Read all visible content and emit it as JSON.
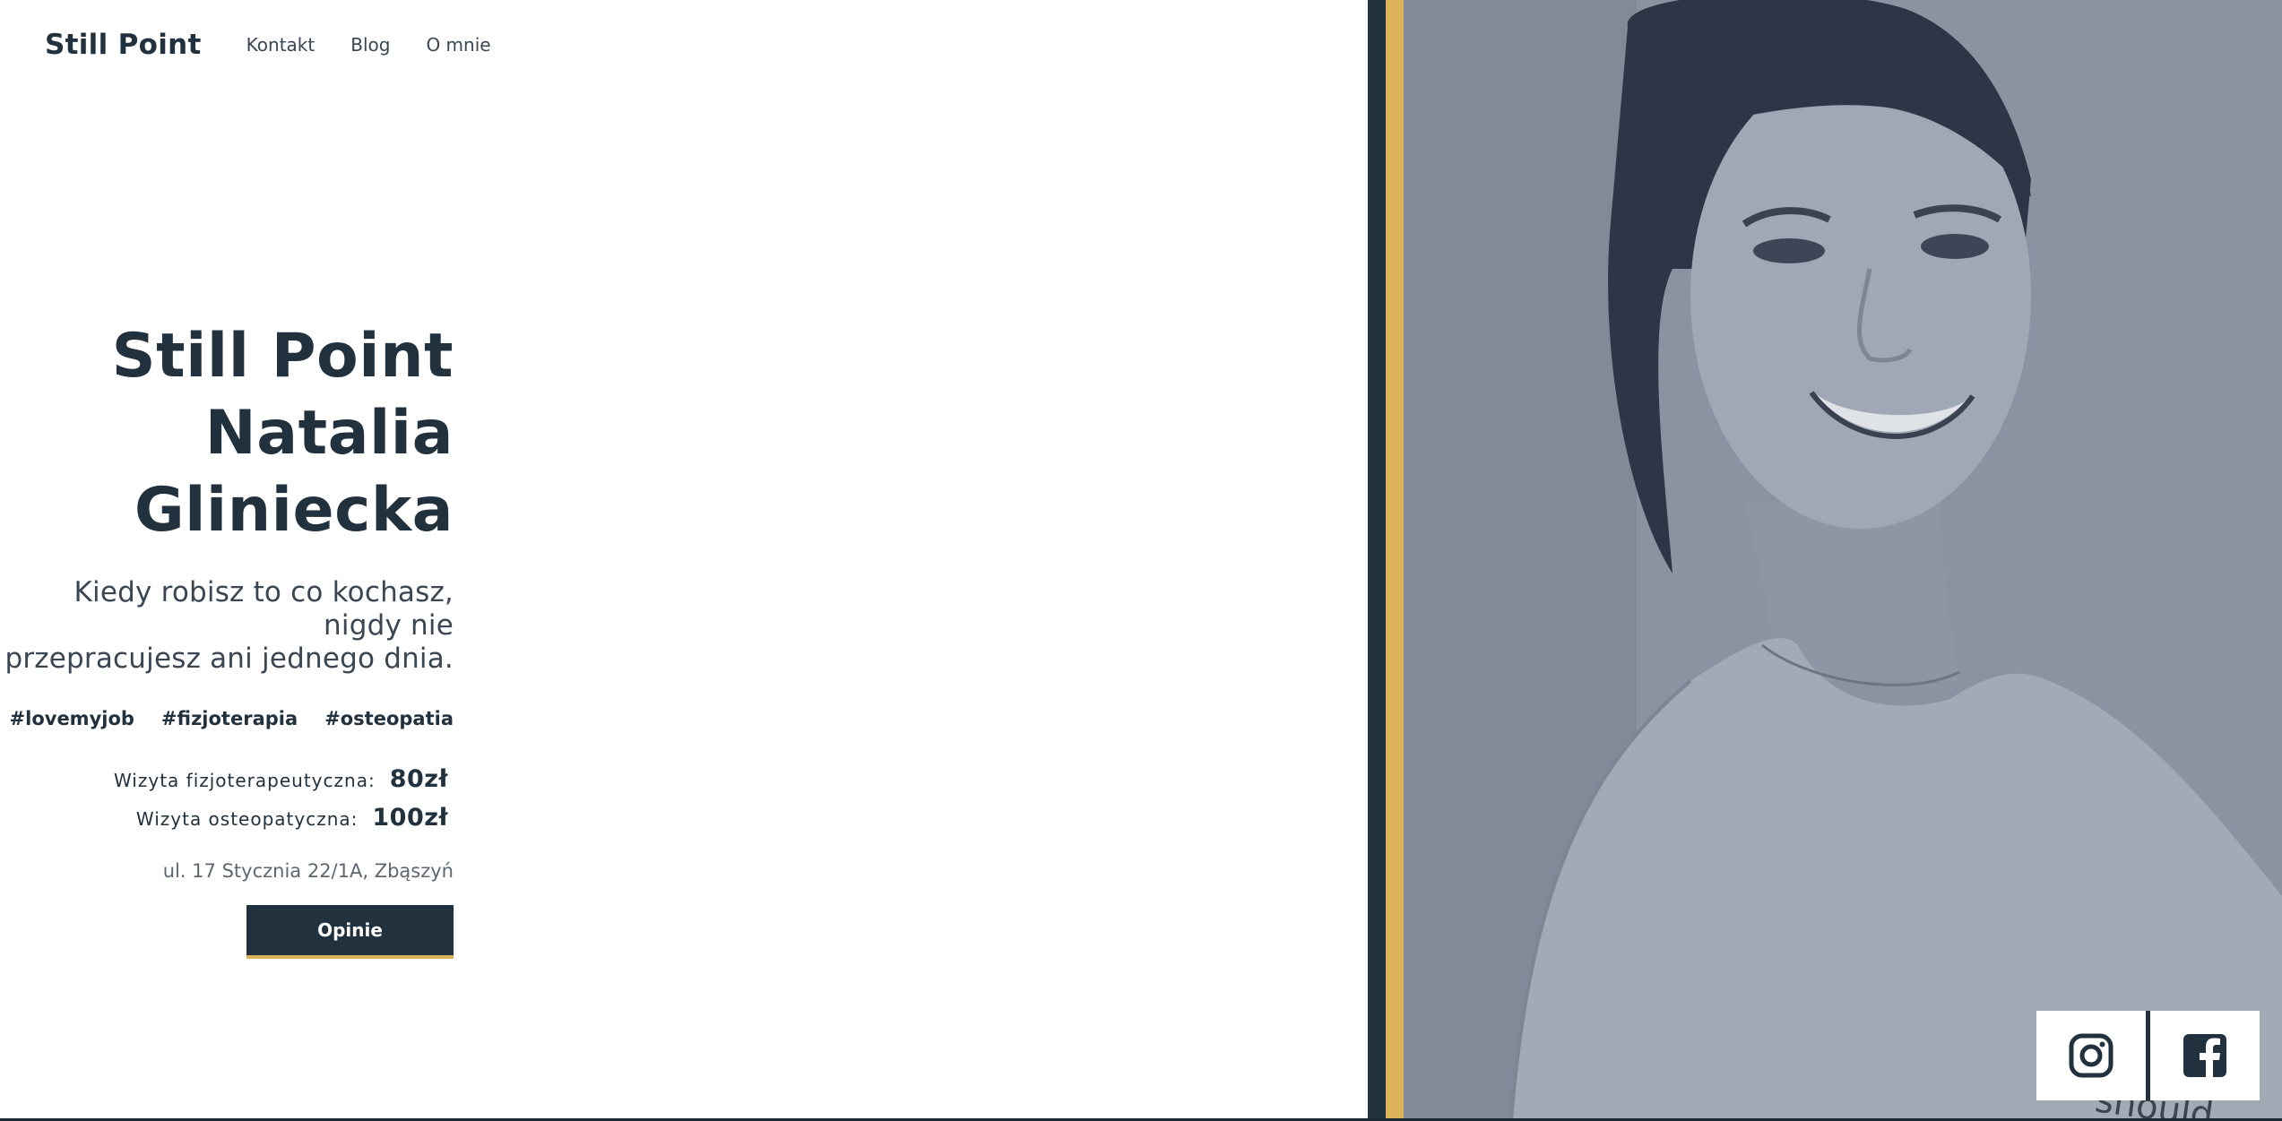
{
  "nav": {
    "brand": "Still Point",
    "links": [
      "Kontakt",
      "Blog",
      "O mnie"
    ]
  },
  "hero": {
    "title_line1": "Still Point",
    "title_line2": "Natalia Gliniecka",
    "tagline_line1": "Kiedy robisz to co kochasz, nigdy nie",
    "tagline_line2": "przepracujesz ani jednego dnia.",
    "tags": [
      "#lovemyjob",
      "#fizjoterapia",
      "#osteopatia"
    ],
    "prices": [
      {
        "label": "Wizyta fizjoterapeutyczna:",
        "value": "80zł"
      },
      {
        "label": "Wizyta osteopatyczna:",
        "value": "100zł"
      }
    ],
    "address": "ul. 17 Stycznia 22/1A, Zbąszyń",
    "button_label": "Opinie"
  },
  "social": {
    "icons": [
      "instagram-icon",
      "facebook-icon"
    ]
  },
  "colors": {
    "navy": "#22313e",
    "gold": "#d9b25a",
    "photo_tint": "#8c95a4"
  }
}
